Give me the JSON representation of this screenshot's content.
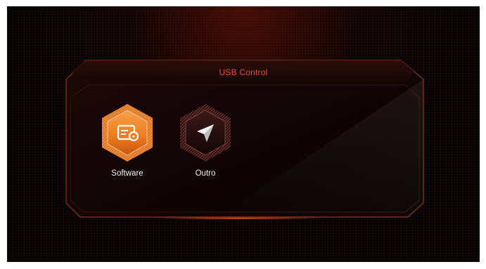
{
  "panel": {
    "title": "USB Control"
  },
  "apps": [
    {
      "label": "Software",
      "icon": "software-disk-icon",
      "selected": true
    },
    {
      "label": "Outro",
      "icon": "send-arrow-icon",
      "selected": false
    }
  ],
  "colors": {
    "accent": "#e2562a",
    "selected_orange": "#f08a2a",
    "background": "#070303",
    "label": "#f2f2f2"
  }
}
